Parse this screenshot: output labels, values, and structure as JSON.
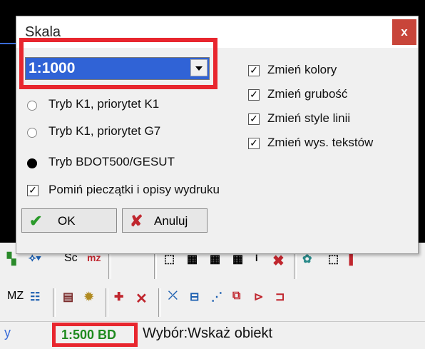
{
  "dialog": {
    "title": "Skala",
    "close_label": "x",
    "scale_select": {
      "value": "1:1000"
    },
    "modes": [
      {
        "label": "Tryb K1, priorytet K1",
        "selected": false
      },
      {
        "label": "Tryb K1, priorytet G7",
        "selected": false
      },
      {
        "label": "Tryb BDOT500/GESUT",
        "selected": true
      }
    ],
    "skip_stamps": {
      "label": "Pomiń pieczątki i opisy wydruku",
      "checked": true
    },
    "options": [
      {
        "label": "Zmień kolory",
        "checked": true
      },
      {
        "label": "Zmień grubość",
        "checked": true
      },
      {
        "label": "Zmień style linii",
        "checked": true
      },
      {
        "label": "Zmień wys. tekstów",
        "checked": true
      }
    ],
    "ok_label": "OK",
    "cancel_label": "Anuluj"
  },
  "toolbar1": {
    "sc_label": "Sc",
    "mz_label": "mz"
  },
  "toolbar2": {
    "mz_label": "MZ"
  },
  "status": {
    "scale": "1:500 BD",
    "message": "Wybór:Wskaż obiekt",
    "left_glyph": "y"
  },
  "colors": {
    "highlight": "#e8262e",
    "selection": "#3063d6",
    "scale_text": "#1e8a1e"
  }
}
